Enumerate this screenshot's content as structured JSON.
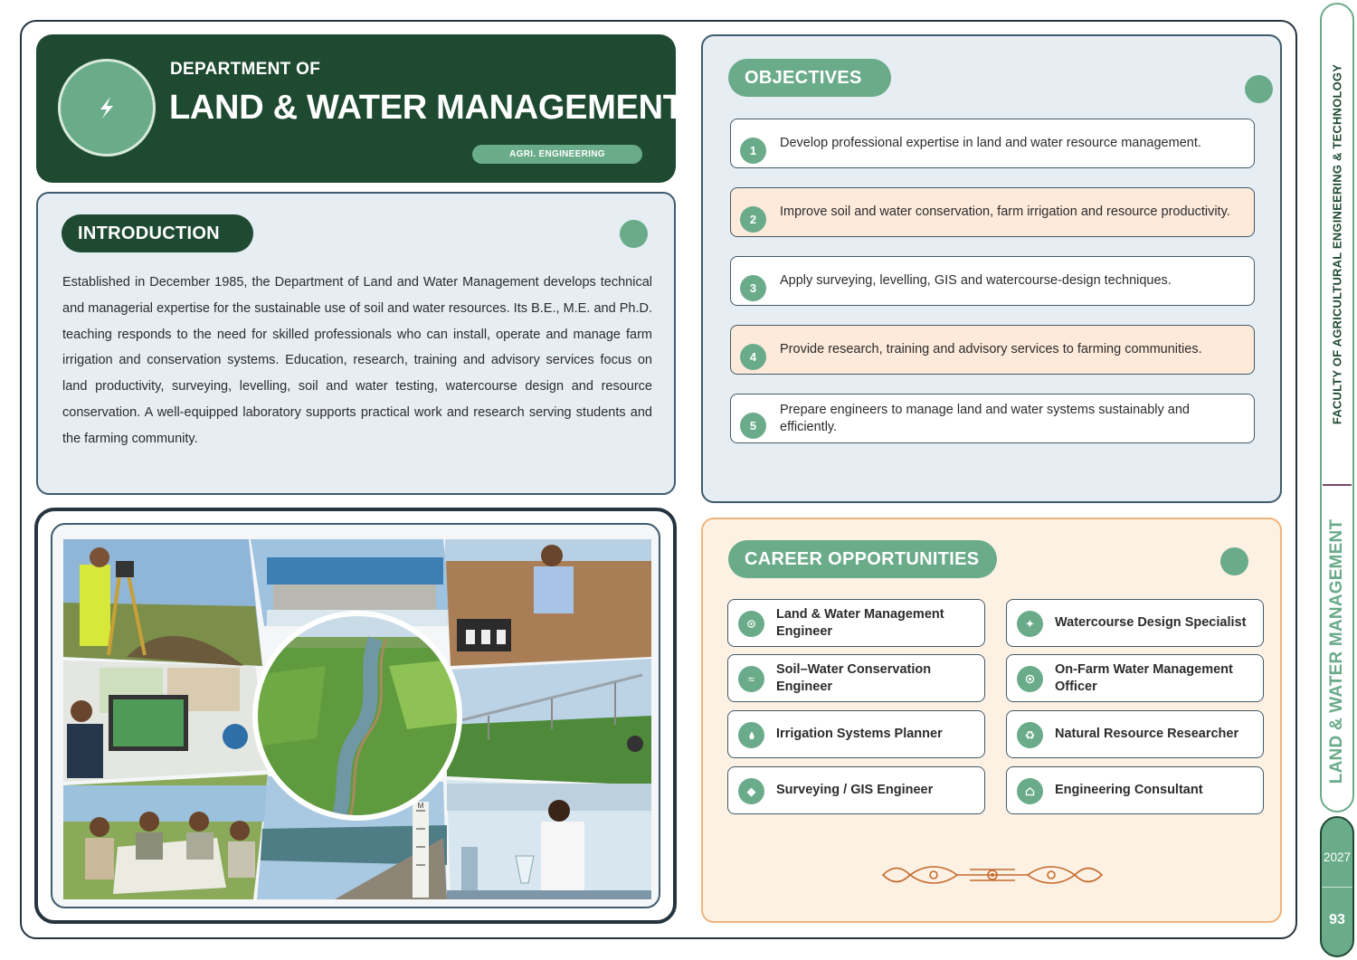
{
  "header": {
    "kicker": "DEPARTMENT OF",
    "title": "LAND & WATER MANAGEMENT",
    "badge": "AGRI. ENGINEERING",
    "logo_icon": "lightning-bolt-icon"
  },
  "introduction": {
    "heading": "INTRODUCTION",
    "body": "Established in December 1985, the Department of Land and Water Management develops technical and managerial expertise for the sustainable use of soil and water resources. Its B.E., M.E. and Ph.D. teaching responds to the need for skilled professionals who can install, operate and manage farm irrigation and conservation systems. Education, research, training and advisory services focus on land productivity, surveying, levelling, soil and water testing, watercourse design and resource conservation. A well-equipped laboratory supports practical work and research serving students and the farming community."
  },
  "objectives": {
    "heading": "OBJECTIVES",
    "items": [
      {
        "num": "1",
        "text": "Develop professional expertise in land and water resource management."
      },
      {
        "num": "2",
        "text": "Improve soil and water conservation, farm irrigation and resource productivity."
      },
      {
        "num": "3",
        "text": "Apply surveying, levelling, GIS and watercourse-design techniques."
      },
      {
        "num": "4",
        "text": "Provide research, training and advisory services to farming communities."
      },
      {
        "num": "5",
        "text": "Prepare engineers to manage land and water systems sustainably and efficiently."
      }
    ]
  },
  "careers": {
    "heading": "CAREER OPPORTUNITIES",
    "items": [
      {
        "label": "Land & Water Management Engineer",
        "icon": "gear-icon"
      },
      {
        "label": "Watercourse Design Specialist",
        "icon": "sparkle-icon"
      },
      {
        "label": "Soil–Water Conservation Engineer",
        "icon": "wave-icon"
      },
      {
        "label": "On-Farm Water Management Officer",
        "icon": "target-icon"
      },
      {
        "label": "Irrigation Systems Planner",
        "icon": "water-drop-icon"
      },
      {
        "label": "Natural Resource Researcher",
        "icon": "recycle-icon"
      },
      {
        "label": "Surveying / GIS Engineer",
        "icon": "diamond-icon"
      },
      {
        "label": "Engineering Consultant",
        "icon": "house-icon"
      }
    ]
  },
  "photo_labels": {
    "gauge_top": "M"
  },
  "sidebar": {
    "faculty": "FACULTY OF AGRICULTURAL  ENGINEERING & TECHNOLOGY",
    "department": "LAND & WATER MANAGEMENT",
    "year": "2027",
    "page": "93"
  },
  "colors": {
    "dark_green": "#1f4a32",
    "accent_green": "#6aab8a",
    "panel_blue": "#e6edf3",
    "peach": "#fdeadb",
    "ornament": "#c46a2c"
  }
}
